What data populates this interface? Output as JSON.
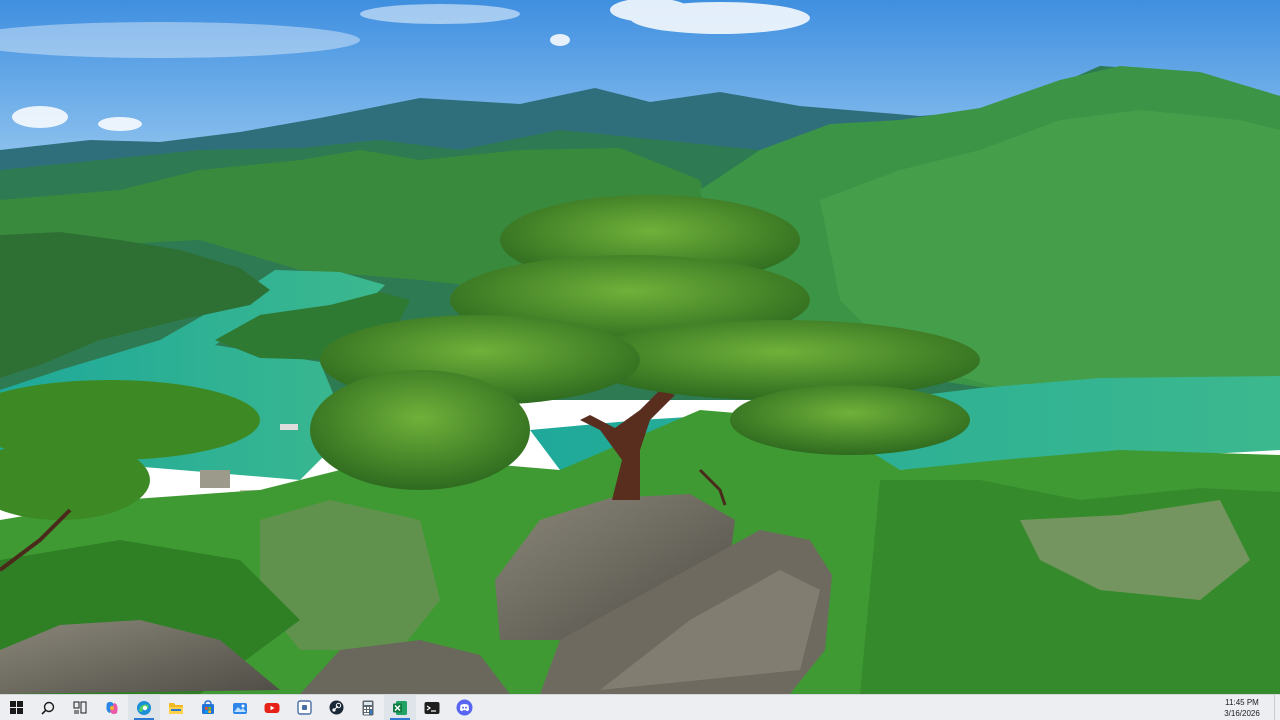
{
  "desktop": {
    "wallpaper": "pine-tree-on-rock-above-lake-and-mountains"
  },
  "taskbar": {
    "background": "#eceef1",
    "items": [
      {
        "id": "start",
        "icon": "windows-logo-icon",
        "label": "Start"
      },
      {
        "id": "search",
        "icon": "search-icon",
        "label": "Search"
      },
      {
        "id": "task-view",
        "icon": "task-view-icon",
        "label": "Task View"
      },
      {
        "id": "copilot",
        "icon": "copilot-icon",
        "label": "Copilot"
      },
      {
        "id": "edge",
        "icon": "edge-icon",
        "label": "Microsoft Edge"
      },
      {
        "id": "file-explorer",
        "icon": "folder-icon",
        "label": "File Explorer"
      },
      {
        "id": "store",
        "icon": "store-icon",
        "label": "Microsoft Store"
      },
      {
        "id": "photos",
        "icon": "photos-icon",
        "label": "Photos"
      },
      {
        "id": "youtube",
        "icon": "youtube-icon",
        "label": "YouTube"
      },
      {
        "id": "app-square",
        "icon": "square-app-icon",
        "label": "App"
      },
      {
        "id": "steam",
        "icon": "steam-icon",
        "label": "Steam"
      },
      {
        "id": "calculator",
        "icon": "calculator-icon",
        "label": "Calculator"
      },
      {
        "id": "excel",
        "icon": "excel-icon",
        "label": "Excel"
      },
      {
        "id": "terminal",
        "icon": "terminal-icon",
        "label": "Terminal"
      },
      {
        "id": "discord",
        "icon": "discord-icon",
        "label": "Discord"
      }
    ],
    "clock": {
      "time": "11:45 PM",
      "date": "3/16/2026"
    }
  }
}
